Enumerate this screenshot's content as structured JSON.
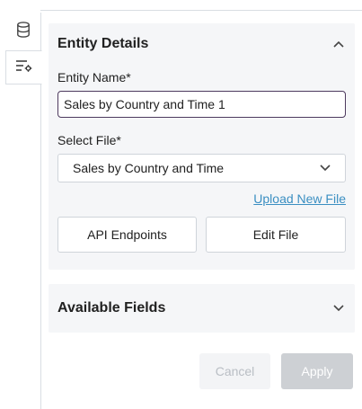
{
  "rail": {
    "tabs": [
      {
        "icon": "database-icon",
        "active": false
      },
      {
        "icon": "filter-settings-icon",
        "active": true
      }
    ]
  },
  "entity_details": {
    "title": "Entity Details",
    "expanded": true,
    "entity_name_label": "Entity Name*",
    "entity_name_value": "Sales by Country and Time 1",
    "select_file_label": "Select File*",
    "select_file_value": "Sales by Country and Time",
    "upload_link": "Upload New File",
    "api_button": "API Endpoints",
    "edit_button": "Edit File"
  },
  "available_fields": {
    "title": "Available Fields",
    "expanded": false
  },
  "footer": {
    "cancel_label": "Cancel",
    "apply_label": "Apply"
  },
  "colors": {
    "panel_bg": "#f5f6f8",
    "input_focus_border": "#4d3a5e",
    "link": "#3b8fc2",
    "apply_disabled": "#cdd0d4"
  }
}
